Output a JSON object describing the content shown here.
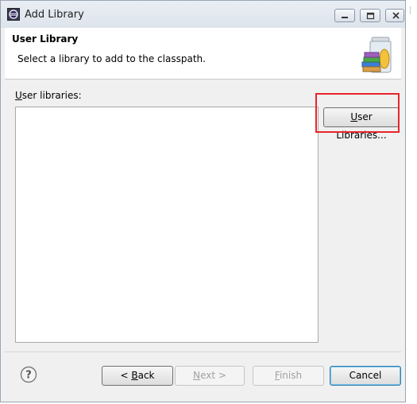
{
  "window": {
    "title": "Add Library",
    "icon": "eclipse-icon",
    "controls": [
      "minimize-icon",
      "restore-icon",
      "close-icon"
    ]
  },
  "header": {
    "title": "User Library",
    "description": "Select a library to add to the classpath.",
    "image": "library-jar-icon"
  },
  "main": {
    "list_label_accel": "U",
    "list_label_rest": "ser libraries:",
    "list_items": [],
    "user_libraries_button_accel": "U",
    "user_libraries_button_rest": "ser Libraries..."
  },
  "footer": {
    "help_icon": "help-icon",
    "back_prefix": "< ",
    "back_accel": "B",
    "back_rest": "ack",
    "next_accel": "N",
    "next_rest": "ext >",
    "finish_accel": "F",
    "finish_rest": "inish",
    "cancel_label": "Cancel"
  },
  "annotation": {
    "highlight_color": "#e8252a"
  }
}
